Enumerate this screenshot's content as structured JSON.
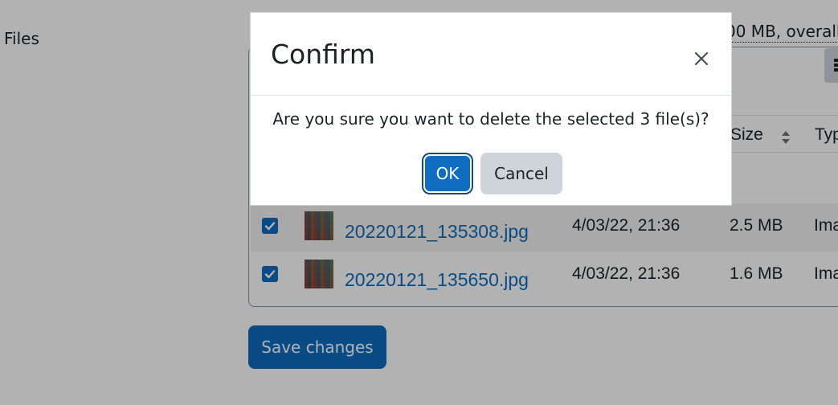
{
  "page": {
    "files_label": "Files",
    "quota_text": "00 MB, overall"
  },
  "table": {
    "columns": {
      "size": "Size",
      "type": "Typ"
    },
    "rows": [
      {
        "name": "20220121_135308.jpg",
        "date": "4/03/22, 21:36",
        "size": "2.5 MB",
        "type": "Ima",
        "checked": true
      },
      {
        "name": "20220121_135650.jpg",
        "date": "4/03/22, 21:36",
        "size": "1.6 MB",
        "type": "Ima",
        "checked": true
      }
    ]
  },
  "form": {
    "save_label": "Save changes"
  },
  "dialog": {
    "title": "Confirm",
    "message": "Are you sure you want to delete the selected 3 file(s)?",
    "ok_label": "OK",
    "cancel_label": "Cancel",
    "close_icon": "close-icon"
  },
  "colors": {
    "primary": "#0f6cbf",
    "secondary": "#ced4da",
    "text": "#1d2125",
    "backdrop": "rgba(0,0,0,0.3)"
  }
}
